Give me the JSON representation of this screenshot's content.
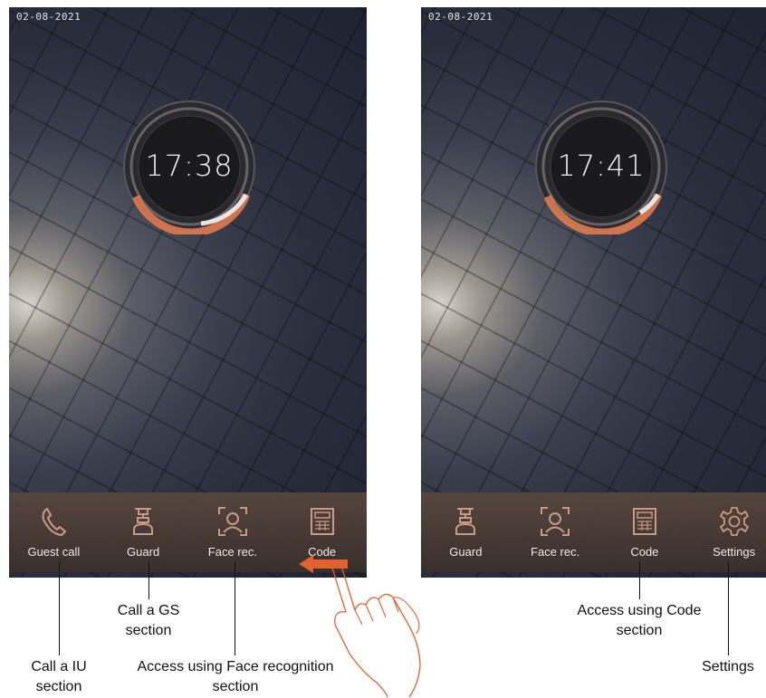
{
  "left_screen": {
    "date": "02-08-2021",
    "time": "17:38",
    "taskbar": [
      {
        "label": "Guest call",
        "icon": "phone-icon"
      },
      {
        "label": "Guard",
        "icon": "guard-icon"
      },
      {
        "label": "Face rec.",
        "icon": "face-scan-icon"
      },
      {
        "label": "Code",
        "icon": "keypad-icon"
      }
    ]
  },
  "right_screen": {
    "date": "02-08-2021",
    "time": "17:41",
    "taskbar": [
      {
        "label": "Guard",
        "icon": "guard-icon"
      },
      {
        "label": "Face rec.",
        "icon": "face-scan-icon"
      },
      {
        "label": "Code",
        "icon": "keypad-icon"
      },
      {
        "label": "Settings",
        "icon": "gear-icon"
      }
    ]
  },
  "annotations": {
    "call_iu": [
      "Call a IU",
      "section"
    ],
    "call_gs": [
      "Call a GS",
      "section"
    ],
    "face_rec": [
      "Access using Face recognition",
      "section"
    ],
    "code": [
      "Access using Code",
      "section"
    ],
    "settings": "Settings"
  },
  "colors": {
    "accent_ring": "#e07a4e",
    "icon": "#c99a86",
    "swipe_arrow": "#e2622d"
  }
}
